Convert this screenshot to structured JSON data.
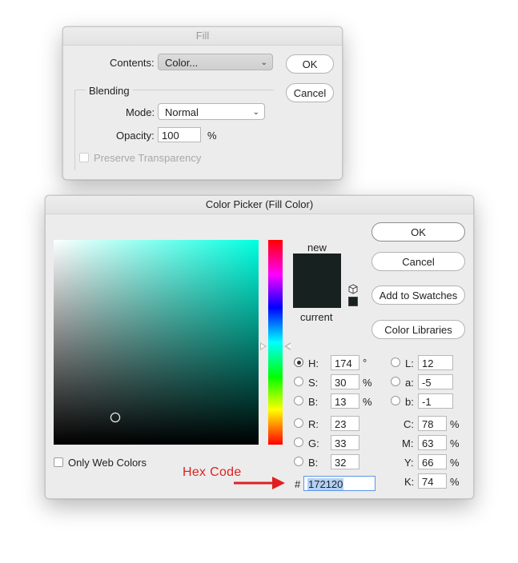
{
  "fill_dialog": {
    "title": "Fill",
    "contents_label": "Contents:",
    "contents_value": "Color...",
    "ok_label": "OK",
    "cancel_label": "Cancel",
    "blending_label": "Blending",
    "mode_label": "Mode:",
    "mode_value": "Normal",
    "opacity_label": "Opacity:",
    "opacity_value": "100",
    "opacity_unit": "%",
    "preserve_label": "Preserve Transparency"
  },
  "color_picker": {
    "title": "Color Picker (Fill Color)",
    "ok_label": "OK",
    "cancel_label": "Cancel",
    "add_swatches_label": "Add to Swatches",
    "color_libraries_label": "Color Libraries",
    "new_label": "new",
    "current_label": "current",
    "new_color": "#172120",
    "current_color": "#172120",
    "field_hue_color": "#00ffe0",
    "only_web_label": "Only Web Colors",
    "hex_label": "#",
    "hex_value": "172120",
    "hsb": {
      "h_label": "H:",
      "h_value": "174",
      "h_unit": "°",
      "s_label": "S:",
      "s_value": "30",
      "s_unit": "%",
      "b_label": "B:",
      "b_value": "13",
      "b_unit": "%"
    },
    "rgb": {
      "r_label": "R:",
      "r_value": "23",
      "g_label": "G:",
      "g_value": "33",
      "b_label": "B:",
      "b_value": "32"
    },
    "lab": {
      "l_label": "L:",
      "l_value": "12",
      "a_label": "a:",
      "a_value": "-5",
      "b_label": "b:",
      "b_value": "-1"
    },
    "cmyk": {
      "c_label": "C:",
      "c_value": "78",
      "m_label": "M:",
      "m_value": "63",
      "y_label": "Y:",
      "y_value": "66",
      "k_label": "K:",
      "k_value": "74",
      "unit": "%"
    }
  },
  "annotation": {
    "text": "Hex Code",
    "color": "#e02020"
  }
}
